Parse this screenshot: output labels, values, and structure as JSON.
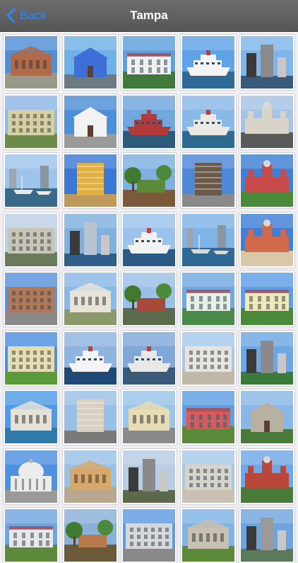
{
  "nav": {
    "back_label": "Back",
    "title": "Tampa"
  },
  "colors": {
    "nav_bg": "#5f5f5f",
    "accent": "#2f86f6",
    "background": "#efeff4"
  },
  "photos": [
    {
      "sky": "#4f8fd8",
      "ground": "#9a9a8a",
      "bld": "#b06a4a",
      "kind": "hall"
    },
    {
      "sky": "#6fb0e8",
      "ground": "#6c7a84",
      "bld": "#3d6fd6",
      "kind": "church"
    },
    {
      "sky": "#5f9fe0",
      "ground": "#3f7a3a",
      "bld": "#f0f0ee",
      "kind": "mansion"
    },
    {
      "sky": "#5fa3e6",
      "ground": "#2d6a97",
      "bld": "#f4f4f4",
      "kind": "ship"
    },
    {
      "sky": "#7fb6ea",
      "ground": "#3a5a7a",
      "bld": "#8a8a8a",
      "kind": "towers"
    },
    {
      "sky": "#8fb8e6",
      "ground": "#6c8a4a",
      "bld": "#d8cfa0",
      "kind": "building"
    },
    {
      "sky": "#4f8ed8",
      "ground": "#9a9a9a",
      "bld": "#f2f2f2",
      "kind": "church"
    },
    {
      "sky": "#6fa7de",
      "ground": "#2c5a7a",
      "bld": "#b43a3a",
      "kind": "ship"
    },
    {
      "sky": "#8ab8e8",
      "ground": "#2f6a92",
      "bld": "#ece8e2",
      "kind": "ship"
    },
    {
      "sky": "#a6c2e4",
      "ground": "#5a5a5a",
      "bld": "#d9d4c8",
      "kind": "palace"
    },
    {
      "sky": "#9fc4ea",
      "ground": "#3a6a8a",
      "bld": "#e8e8e8",
      "kind": "marina"
    },
    {
      "sky": "#3b78d6",
      "ground": "#c09a5a",
      "bld": "#e2b040",
      "kind": "tower"
    },
    {
      "sky": "#7fb0e0",
      "ground": "#7a5a3a",
      "bld": "#5a8a3a",
      "kind": "trees"
    },
    {
      "sky": "#4f88d8",
      "ground": "#8a8a8a",
      "bld": "#6a5a4a",
      "kind": "tower"
    },
    {
      "sky": "#3f7fd4",
      "ground": "#4a8a3a",
      "bld": "#c84a4a",
      "kind": "palace"
    },
    {
      "sky": "#bcd0e6",
      "ground": "#6a7a5a",
      "bld": "#c8c4b6",
      "kind": "building"
    },
    {
      "sky": "#7fb0e0",
      "ground": "#2f5f8a",
      "bld": "#b8c4d0",
      "kind": "towers"
    },
    {
      "sky": "#9ac2ea",
      "ground": "#2b5a86",
      "bld": "#f2f2f2",
      "kind": "ship"
    },
    {
      "sky": "#7fb4e6",
      "ground": "#2f6a96",
      "bld": "#d8d8d8",
      "kind": "marina"
    },
    {
      "sky": "#3f7fd8",
      "ground": "#d8c8a8",
      "bld": "#d06a4a",
      "kind": "palace"
    },
    {
      "sky": "#5a92dc",
      "ground": "#8a8a8a",
      "bld": "#b07a5a",
      "kind": "building"
    },
    {
      "sky": "#8ab8e6",
      "ground": "#8a9a6a",
      "bld": "#e8e4da",
      "kind": "hall"
    },
    {
      "sky": "#9ac0e6",
      "ground": "#5a6a4a",
      "bld": "#a84a3a",
      "kind": "trees"
    },
    {
      "sky": "#6fa8e2",
      "ground": "#4a8a4a",
      "bld": "#e8f0e4",
      "kind": "mansion"
    },
    {
      "sky": "#5f9ee6",
      "ground": "#4a8a3a",
      "bld": "#f0e8b8",
      "kind": "mansion"
    },
    {
      "sky": "#4f90e0",
      "ground": "#5a9a3a",
      "bld": "#e6dcb0",
      "kind": "building"
    },
    {
      "sky": "#8fb4e0",
      "ground": "#1f4a78",
      "bld": "#f4f4f4",
      "kind": "ship"
    },
    {
      "sky": "#7fa8d8",
      "ground": "#3a5a7a",
      "bld": "#e8e8e8",
      "kind": "ship"
    },
    {
      "sky": "#a8c8ea",
      "ground": "#c0b8a8",
      "bld": "#e8e4dc",
      "kind": "building"
    },
    {
      "sky": "#6fa6e4",
      "ground": "#3a7a3a",
      "bld": "#8a8a8a",
      "kind": "towers"
    },
    {
      "sky": "#4f9ae6",
      "ground": "#2f7aa8",
      "bld": "#e6e2d8",
      "kind": "hall"
    },
    {
      "sky": "#9abfe6",
      "ground": "#7a7a7a",
      "bld": "#d8d0c0",
      "kind": "tower"
    },
    {
      "sky": "#9ac4ea",
      "ground": "#8a8a8a",
      "bld": "#e8dcb4",
      "kind": "hall"
    },
    {
      "sky": "#5f9ee0",
      "ground": "#5a8a3a",
      "bld": "#d85a5a",
      "kind": "mansion"
    },
    {
      "sky": "#8ab8e6",
      "ground": "#4a7a3a",
      "bld": "#b8b0a0",
      "kind": "church"
    },
    {
      "sky": "#4f90e0",
      "ground": "#9a9a9a",
      "bld": "#ececec",
      "kind": "dome"
    },
    {
      "sky": "#9ac0e6",
      "ground": "#b8a890",
      "bld": "#d8a86a",
      "kind": "hall"
    },
    {
      "sky": "#b8cce4",
      "ground": "#5a6a4a",
      "bld": "#8a8a8a",
      "kind": "towers"
    },
    {
      "sky": "#a8c8ea",
      "ground": "#c8c0b0",
      "bld": "#d8d4cc",
      "kind": "building"
    },
    {
      "sky": "#6fa8e6",
      "ground": "#4a7a3a",
      "bld": "#b8483a",
      "kind": "palace"
    },
    {
      "sky": "#6fa6e0",
      "ground": "#5a8a3a",
      "bld": "#e8e8e8",
      "kind": "mansion"
    },
    {
      "sky": "#8ab0d8",
      "ground": "#6a5a3a",
      "bld": "#b87a4a",
      "kind": "trees"
    },
    {
      "sky": "#5f9ae2",
      "ground": "#8a8a8a",
      "bld": "#d8d8d8",
      "kind": "building"
    },
    {
      "sky": "#7fb4e6",
      "ground": "#5a8a3a",
      "bld": "#c8c0b0",
      "kind": "hall"
    },
    {
      "sky": "#6fa4de",
      "ground": "#5a7a5a",
      "bld": "#9a9a9a",
      "kind": "towers"
    }
  ]
}
